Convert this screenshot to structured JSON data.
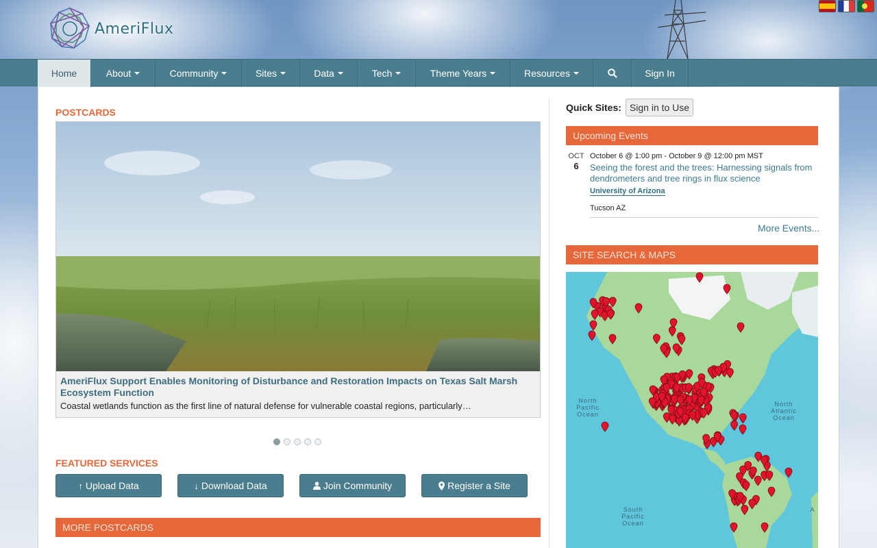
{
  "header": {
    "logo_text": "AmeriFlux",
    "flags": [
      "Spanish",
      "French",
      "Portuguese"
    ]
  },
  "nav": {
    "items": [
      {
        "label": "Home",
        "dropdown": false,
        "active": true
      },
      {
        "label": "About",
        "dropdown": true
      },
      {
        "label": "Community",
        "dropdown": true
      },
      {
        "label": "Sites",
        "dropdown": true
      },
      {
        "label": "Data",
        "dropdown": true
      },
      {
        "label": "Tech",
        "dropdown": true
      },
      {
        "label": "Theme Years",
        "dropdown": true
      },
      {
        "label": "Resources",
        "dropdown": true
      }
    ],
    "search_icon": "search-icon",
    "signin": "Sign In"
  },
  "postcards": {
    "heading": "POSTCARDS",
    "slide": {
      "title": "AmeriFlux Support Enables Monitoring of Disturbance and Restoration Impacts on Texas Salt Marsh Ecosystem Function",
      "text": "Coastal wetlands function as the first line of natural defense for vulnerable coastal regions, particularly…"
    },
    "dots": 5,
    "active_dot": 1
  },
  "featured": {
    "heading": "FEATURED SERVICES",
    "buttons": [
      {
        "icon": "↑",
        "label": "Upload Data"
      },
      {
        "icon": "↓",
        "label": "Download Data"
      },
      {
        "icon": "👤",
        "label": "Join Community"
      },
      {
        "icon": "📍",
        "label": "Register a Site"
      }
    ]
  },
  "more_postcards": "MORE POSTCARDS",
  "sidebar": {
    "quick_sites_label": "Quick Sites:",
    "quick_sites_button": "Sign in to Use",
    "events_heading": "Upcoming Events",
    "event": {
      "month": "OCT",
      "day": "6",
      "when": "October 6 @ 1:00 pm - October 9 @ 12:00 pm MST",
      "title": "Seeing the forest and the trees: Harnessing signals from dendrometers and tree rings in flux science",
      "org": "University of Arizona",
      "location": "Tucson AZ"
    },
    "more_events": "More Events...",
    "map_heading": "SITE SEARCH & MAPS",
    "map_labels": {
      "north_pacific": "North\nPacific\nOcean",
      "north_atlantic": "North\nAtlantic\nOcean",
      "south_pacific": "South\nPacific\nOcean"
    }
  }
}
